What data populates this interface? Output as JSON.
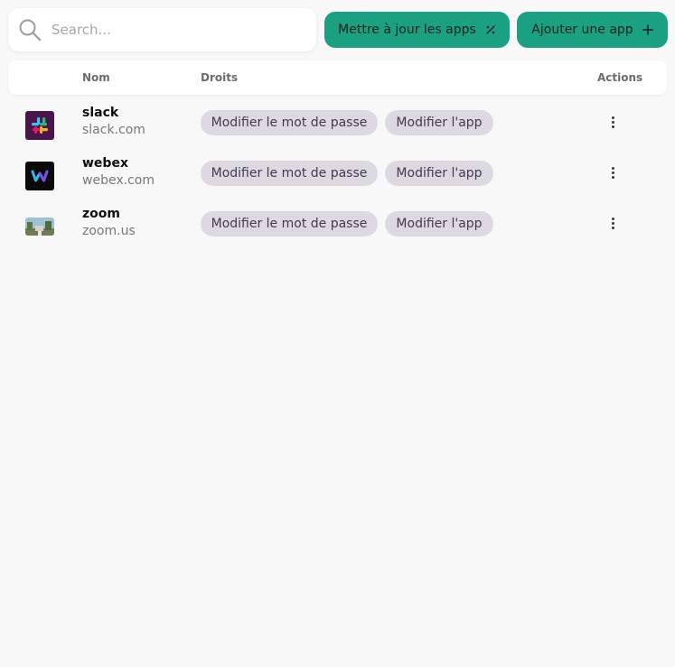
{
  "search": {
    "placeholder": "Search..."
  },
  "toolbar": {
    "update_label": "Mettre à jour les apps",
    "update_icon": "percent-icon",
    "add_label": "Ajouter une app",
    "add_icon": "plus-icon"
  },
  "table": {
    "headers": {
      "name": "Nom",
      "rights": "Droits",
      "actions": "Actions"
    },
    "rows": [
      {
        "name": "slack",
        "domain": "slack.com",
        "logo": "slack-logo-icon",
        "rights": [
          "Modifier le mot de passe",
          "Modifier l'app"
        ]
      },
      {
        "name": "webex",
        "domain": "webex.com",
        "logo": "webex-logo-icon",
        "rights": [
          "Modifier le mot de passe",
          "Modifier l'app"
        ]
      },
      {
        "name": "zoom",
        "domain": "zoom.us",
        "logo": "zoom-logo-image",
        "rights": [
          "Modifier le mot de passe",
          "Modifier l'app"
        ]
      }
    ]
  },
  "colors": {
    "accent": "#1ba081",
    "chip_bg": "#ddd9e3",
    "page_bg": "#f8f8f9"
  }
}
